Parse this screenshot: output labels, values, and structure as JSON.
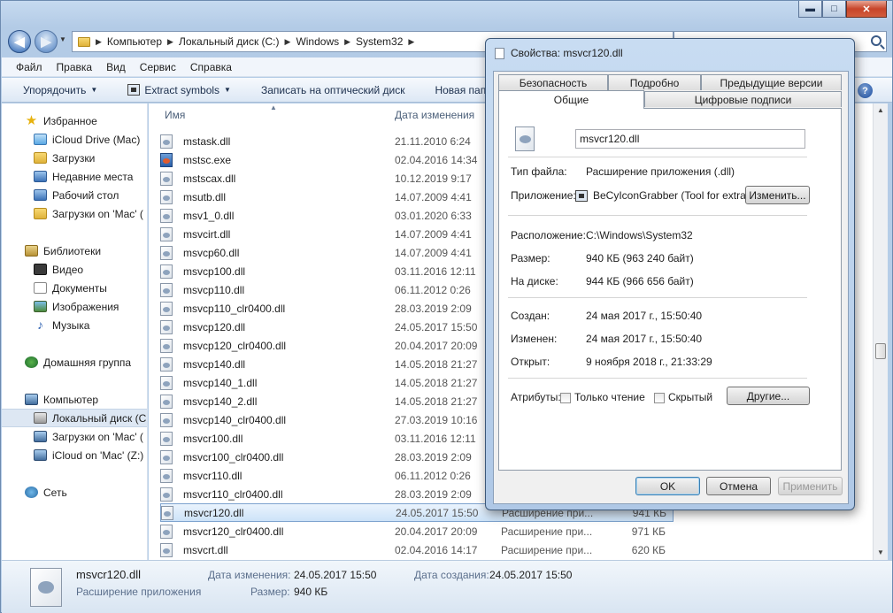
{
  "window": {
    "controls": {
      "minimize": "▬",
      "maximize": "□",
      "close": "✕"
    }
  },
  "address": {
    "crumbs": [
      "Компьютер",
      "Локальный диск (C:)",
      "Windows",
      "System32"
    ],
    "back": "◀",
    "forward": "▶"
  },
  "menu": [
    "Файл",
    "Правка",
    "Вид",
    "Сервис",
    "Справка"
  ],
  "toolbar": {
    "organize": "Упорядочить",
    "extract": "Extract symbols",
    "burn": "Записать на оптический диск",
    "new_folder": "Новая папка"
  },
  "nav": {
    "items": [
      {
        "label": "Избранное",
        "icon": "star-icon"
      },
      {
        "label": "iCloud Drive (Mac)",
        "icon": "cloud-icon"
      },
      {
        "label": "Загрузки",
        "icon": "folder-icon"
      },
      {
        "label": "Недавние места",
        "icon": "recent-icon"
      },
      {
        "label": "Рабочий стол",
        "icon": "desktop-icon"
      },
      {
        "label": "Загрузки on 'Mac' (",
        "icon": "folder-icon"
      },
      {
        "label": "Библиотеки",
        "icon": "library-icon"
      },
      {
        "label": "Видео",
        "icon": "video-icon"
      },
      {
        "label": "Документы",
        "icon": "document-icon"
      },
      {
        "label": "Изображения",
        "icon": "picture-icon"
      },
      {
        "label": "Музыка",
        "icon": "music-icon"
      },
      {
        "label": "Домашняя группа",
        "icon": "homegroup-icon"
      },
      {
        "label": "Компьютер",
        "icon": "computer-icon"
      },
      {
        "label": "Локальный диск (C",
        "icon": "drive-icon"
      },
      {
        "label": "Загрузки on 'Mac' (",
        "icon": "network-drive-icon"
      },
      {
        "label": "iCloud on 'Mac' (Z:)",
        "icon": "network-drive-icon"
      },
      {
        "label": "Сеть",
        "icon": "network-icon"
      }
    ]
  },
  "files": {
    "columns": {
      "name": "Имя",
      "date": "Дата изменения"
    },
    "rows": [
      {
        "name": "mstask.dll",
        "date": "21.11.2010 6:24",
        "type": "",
        "size": ""
      },
      {
        "name": "mstsc.exe",
        "date": "02.04.2016 14:34",
        "type": "",
        "size": ""
      },
      {
        "name": "mstscax.dll",
        "date": "10.12.2019 9:17",
        "type": "",
        "size": ""
      },
      {
        "name": "msutb.dll",
        "date": "14.07.2009 4:41",
        "type": "",
        "size": ""
      },
      {
        "name": "msv1_0.dll",
        "date": "03.01.2020 6:33",
        "type": "",
        "size": ""
      },
      {
        "name": "msvcirt.dll",
        "date": "14.07.2009 4:41",
        "type": "",
        "size": ""
      },
      {
        "name": "msvcp60.dll",
        "date": "14.07.2009 4:41",
        "type": "",
        "size": ""
      },
      {
        "name": "msvcp100.dll",
        "date": "03.11.2016 12:11",
        "type": "",
        "size": ""
      },
      {
        "name": "msvcp110.dll",
        "date": "06.11.2012 0:26",
        "type": "",
        "size": ""
      },
      {
        "name": "msvcp110_clr0400.dll",
        "date": "28.03.2019 2:09",
        "type": "",
        "size": ""
      },
      {
        "name": "msvcp120.dll",
        "date": "24.05.2017 15:50",
        "type": "",
        "size": ""
      },
      {
        "name": "msvcp120_clr0400.dll",
        "date": "20.04.2017 20:09",
        "type": "",
        "size": ""
      },
      {
        "name": "msvcp140.dll",
        "date": "14.05.2018 21:27",
        "type": "",
        "size": ""
      },
      {
        "name": "msvcp140_1.dll",
        "date": "14.05.2018 21:27",
        "type": "",
        "size": ""
      },
      {
        "name": "msvcp140_2.dll",
        "date": "14.05.2018 21:27",
        "type": "",
        "size": ""
      },
      {
        "name": "msvcp140_clr0400.dll",
        "date": "27.03.2019 10:16",
        "type": "",
        "size": ""
      },
      {
        "name": "msvcr100.dll",
        "date": "03.11.2016 12:11",
        "type": "",
        "size": ""
      },
      {
        "name": "msvcr100_clr0400.dll",
        "date": "28.03.2019 2:09",
        "type": "",
        "size": ""
      },
      {
        "name": "msvcr110.dll",
        "date": "06.11.2012 0:26",
        "type": "",
        "size": ""
      },
      {
        "name": "msvcr110_clr0400.dll",
        "date": "28.03.2019 2:09",
        "type": "",
        "size": ""
      },
      {
        "name": "msvcr120.dll",
        "date": "24.05.2017 15:50",
        "type": "Расширение при...",
        "size": "941 КБ"
      },
      {
        "name": "msvcr120_clr0400.dll",
        "date": "20.04.2017 20:09",
        "type": "Расширение при...",
        "size": "971 КБ"
      },
      {
        "name": "msvcrt.dll",
        "date": "02.04.2016 14:17",
        "type": "Расширение при...",
        "size": "620 КБ"
      }
    ]
  },
  "details": {
    "name": "msvcr120.dll",
    "type": "Расширение приложения",
    "modified_label": "Дата изменения:",
    "modified": "24.05.2017 15:50",
    "size_label": "Размер:",
    "size": "940 КБ",
    "created_label": "Дата создания:",
    "created": "24.05.2017 15:50"
  },
  "dialog": {
    "title": "Свойства: msvcr120.dll",
    "tabs_back": [
      "Безопасность",
      "Подробно",
      "Предыдущие версии"
    ],
    "tabs_front": [
      "Общие",
      "Цифровые подписи"
    ],
    "filename": "msvcr120.dll",
    "props": {
      "filetype_label": "Тип файла:",
      "filetype": "Расширение приложения (.dll)",
      "app_label": "Приложение:",
      "app": "BeCyIconGrabber (Tool for extracti",
      "change_button": "Изменить...",
      "location_label": "Расположение:",
      "location": "C:\\Windows\\System32",
      "size_label": "Размер:",
      "size": "940 КБ (963 240 байт)",
      "disk_label": "На диске:",
      "disk": "944 КБ (966 656 байт)",
      "created_label": "Создан:",
      "created": "24 мая 2017 г., 15:50:40",
      "modified_label": "Изменен:",
      "modified": "24 мая 2017 г., 15:50:40",
      "opened_label": "Открыт:",
      "opened": "9 ноября 2018 г., 21:33:29",
      "attrs_label": "Атрибуты:",
      "readonly": "Только чтение",
      "hidden": "Скрытый",
      "other_button": "Другие..."
    },
    "buttons": {
      "ok": "OK",
      "cancel": "Отмена",
      "apply": "Применить"
    }
  }
}
